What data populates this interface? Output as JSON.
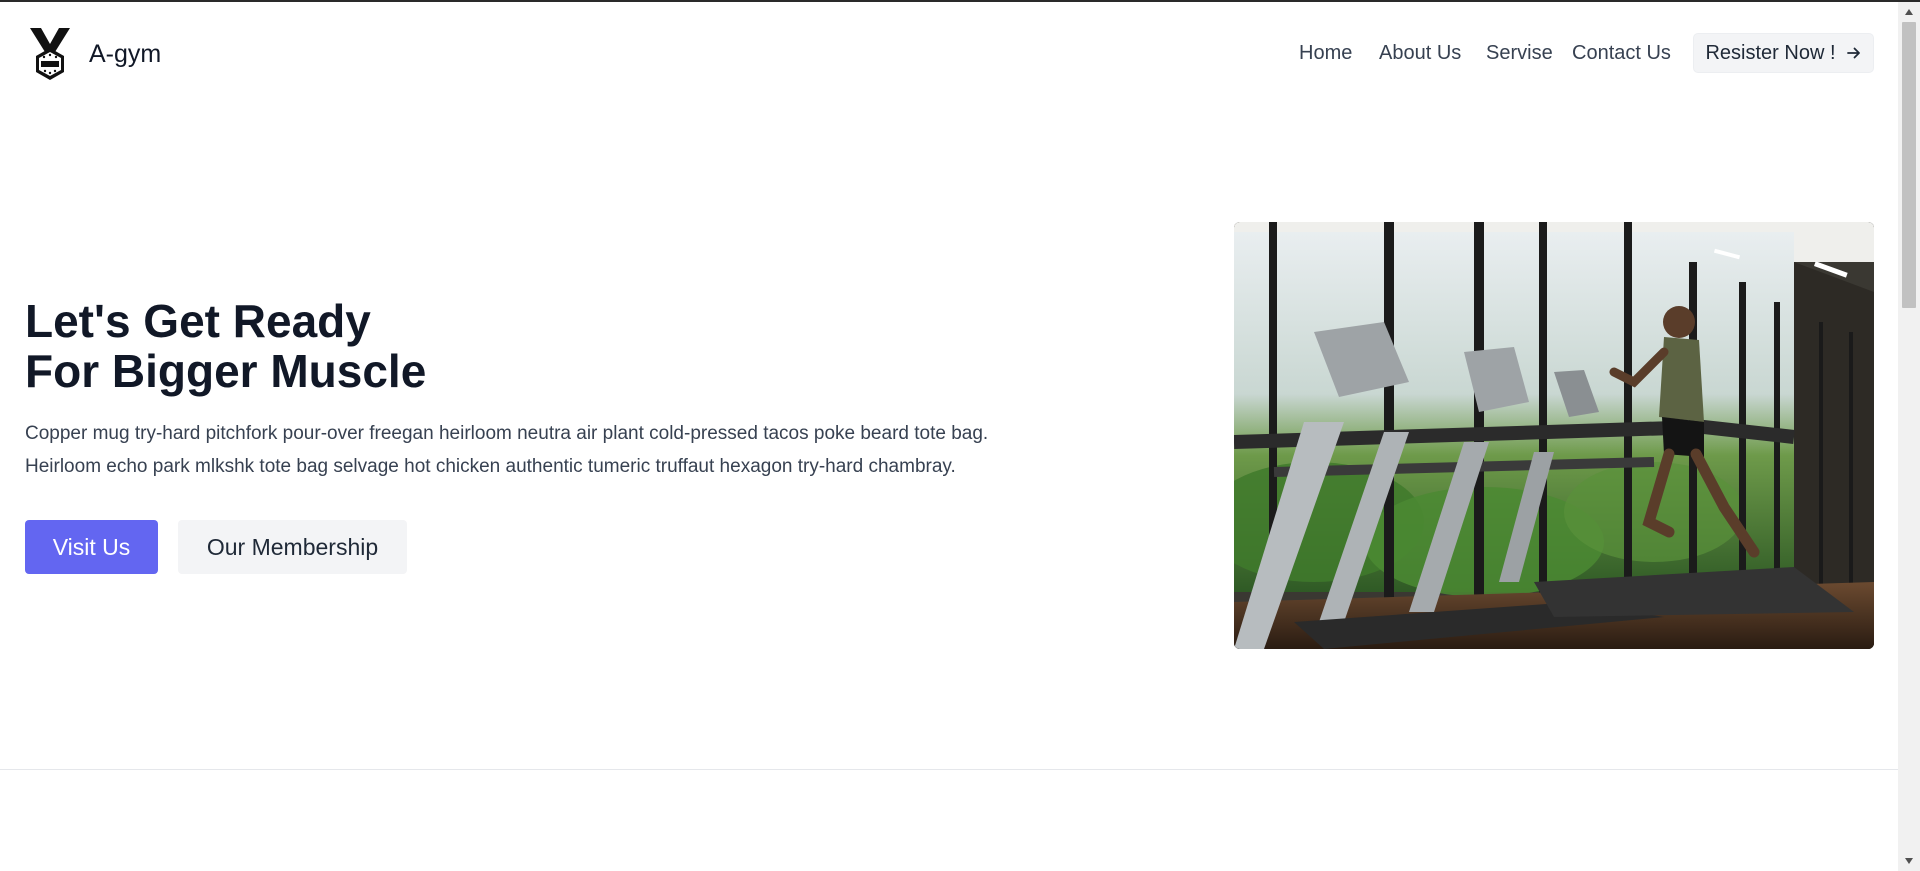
{
  "header": {
    "brand": "A-gym",
    "logo_icon": "medal-gym-logo-icon",
    "nav": [
      {
        "label": "Home"
      },
      {
        "label": "About Us"
      },
      {
        "label": "Servise"
      },
      {
        "label": "Contact Us"
      }
    ],
    "register_label": "Resister Now !",
    "register_icon": "arrow-right-icon"
  },
  "hero": {
    "title_lines": [
      "Let's Get Ready",
      "For Bigger Muscle"
    ],
    "description_lines": [
      "Copper mug try-hard pitchfork pour-over freegan heirloom neutra air plant cold-pressed tacos poke beard tote bag.",
      "Heirloom echo park mlkshk tote bag selvage hot chicken authentic tumeric truffaut hexagon try-hard chambray."
    ],
    "primary_button": "Visit Us",
    "secondary_button": "Our Membership",
    "image_subject": "man running on treadmill in gym"
  },
  "colors": {
    "accent": "#6366f1",
    "text_dark": "#111827",
    "button_gray": "#f3f4f6"
  }
}
